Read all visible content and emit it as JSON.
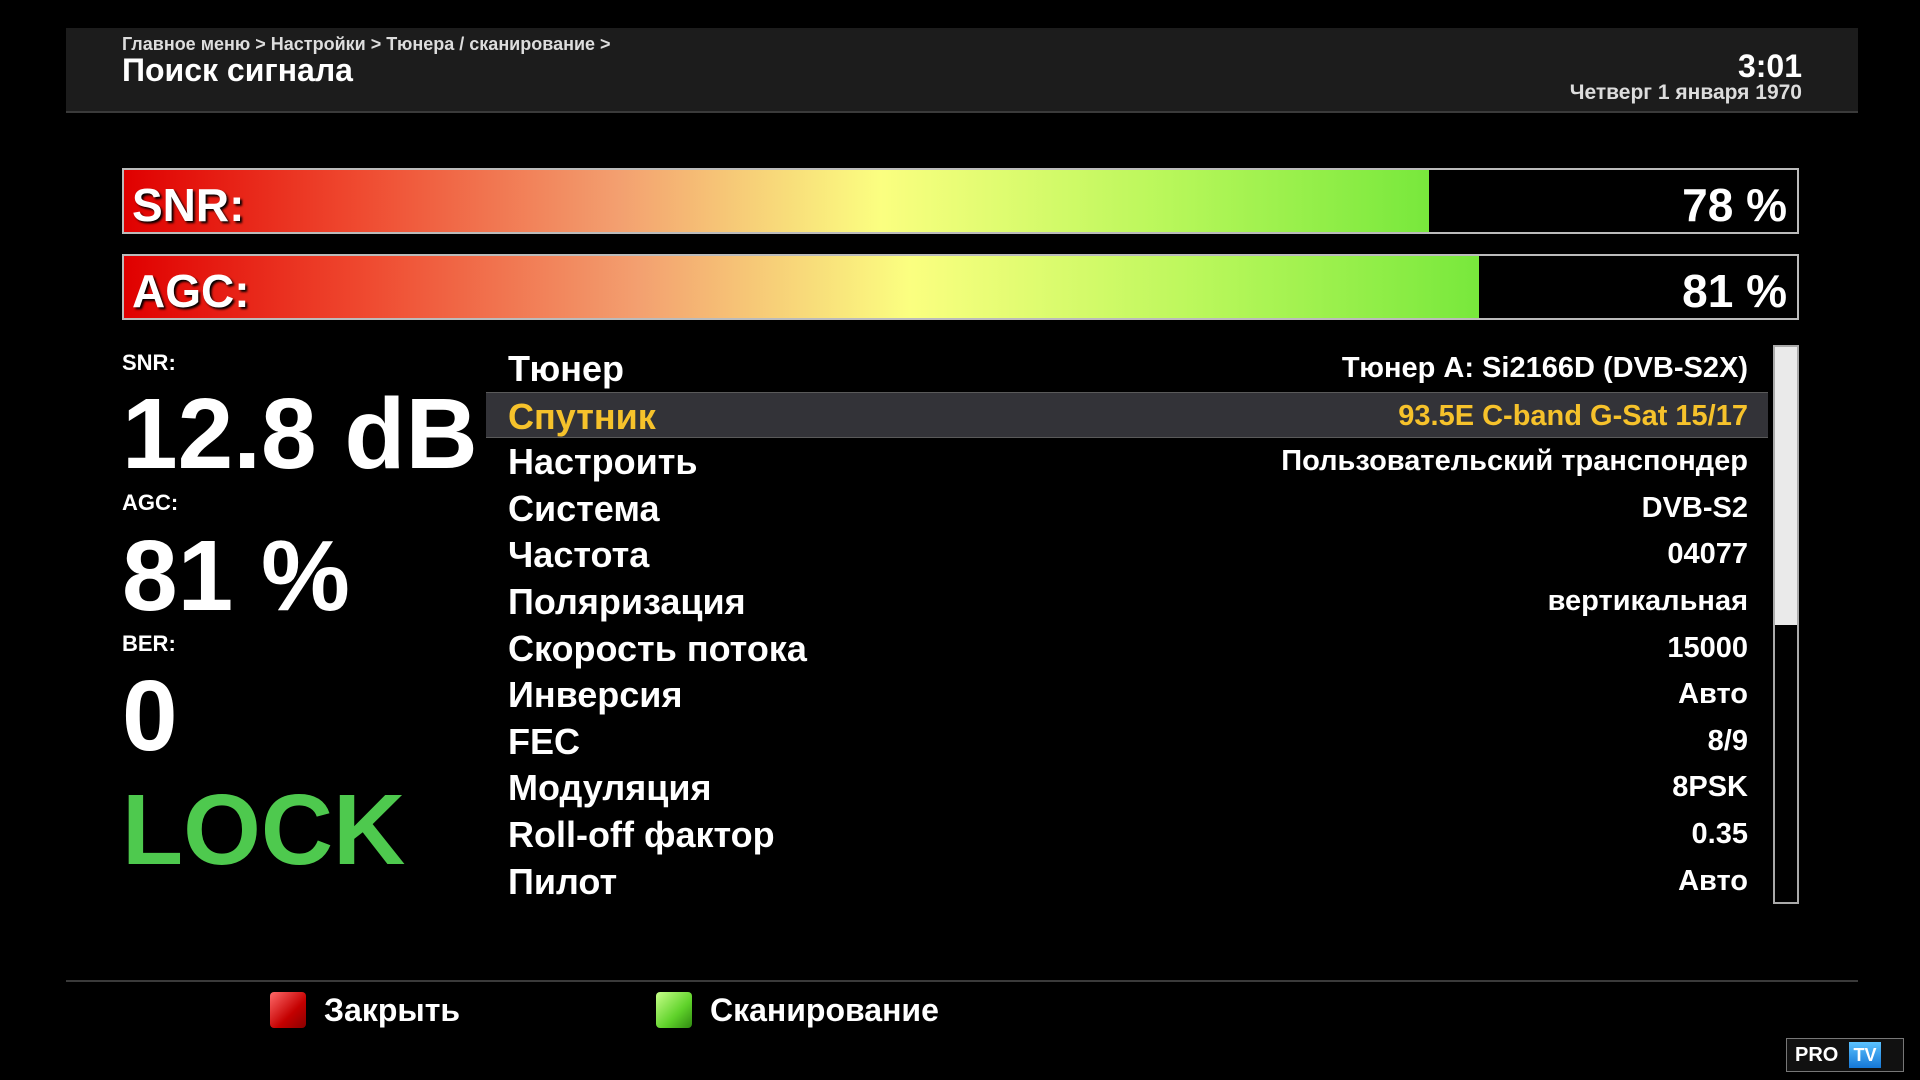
{
  "header": {
    "breadcrumb": "Главное меню > Настройки > Тюнера / сканирование >",
    "title": "Поиск сигнала",
    "time": "3:01",
    "date": "Четверг  1 января 1970"
  },
  "bars": {
    "snr": {
      "label": "SNR:",
      "value_text": "78 %",
      "level": 78
    },
    "agc": {
      "label": "AGC:",
      "value_text": "81 %",
      "level": 81
    }
  },
  "stats": {
    "snr_label": "SNR:",
    "snr_value": "12.8 dB",
    "agc_label": "AGC:",
    "agc_value": "81 %",
    "ber_label": "BER:",
    "ber_value": "0",
    "lock_text": "LOCK",
    "lock_color": "#4ec94e"
  },
  "params": [
    {
      "label": "Тюнер",
      "value": "Тюнер A: Si2166D (DVB-S2X)",
      "selected": false
    },
    {
      "label": "Спутник",
      "value": "93.5E C-band G-Sat 15/17",
      "selected": true
    },
    {
      "label": "Настроить",
      "value": "Пользовательский транспондер",
      "selected": false
    },
    {
      "label": "Система",
      "value": "DVB-S2",
      "selected": false
    },
    {
      "label": "Частота",
      "value": "04077",
      "selected": false
    },
    {
      "label": "Поляризация",
      "value": "вертикальная",
      "selected": false
    },
    {
      "label": "Скорость потока",
      "value": "15000",
      "selected": false
    },
    {
      "label": "Инверсия",
      "value": "Авто",
      "selected": false
    },
    {
      "label": "FEC",
      "value": "8/9",
      "selected": false
    },
    {
      "label": "Модуляция",
      "value": "8PSK",
      "selected": false
    },
    {
      "label": "Roll-off фактор",
      "value": "0.35",
      "selected": false
    },
    {
      "label": "Пилот",
      "value": "Авто",
      "selected": false
    }
  ],
  "scrollbar": {
    "visible_fraction": 0.5
  },
  "footer": {
    "close_label": "Закрыть",
    "close_key_icon": "red-key-icon",
    "scan_label": "Сканирование",
    "scan_key_icon": "green-key-icon"
  },
  "watermark": {
    "text_main": "PRO",
    "text_tv": "TV"
  },
  "colors": {
    "selected_text": "#f6c22b",
    "lock": "#4ec94e",
    "header_bg": "#1c1c1c"
  }
}
